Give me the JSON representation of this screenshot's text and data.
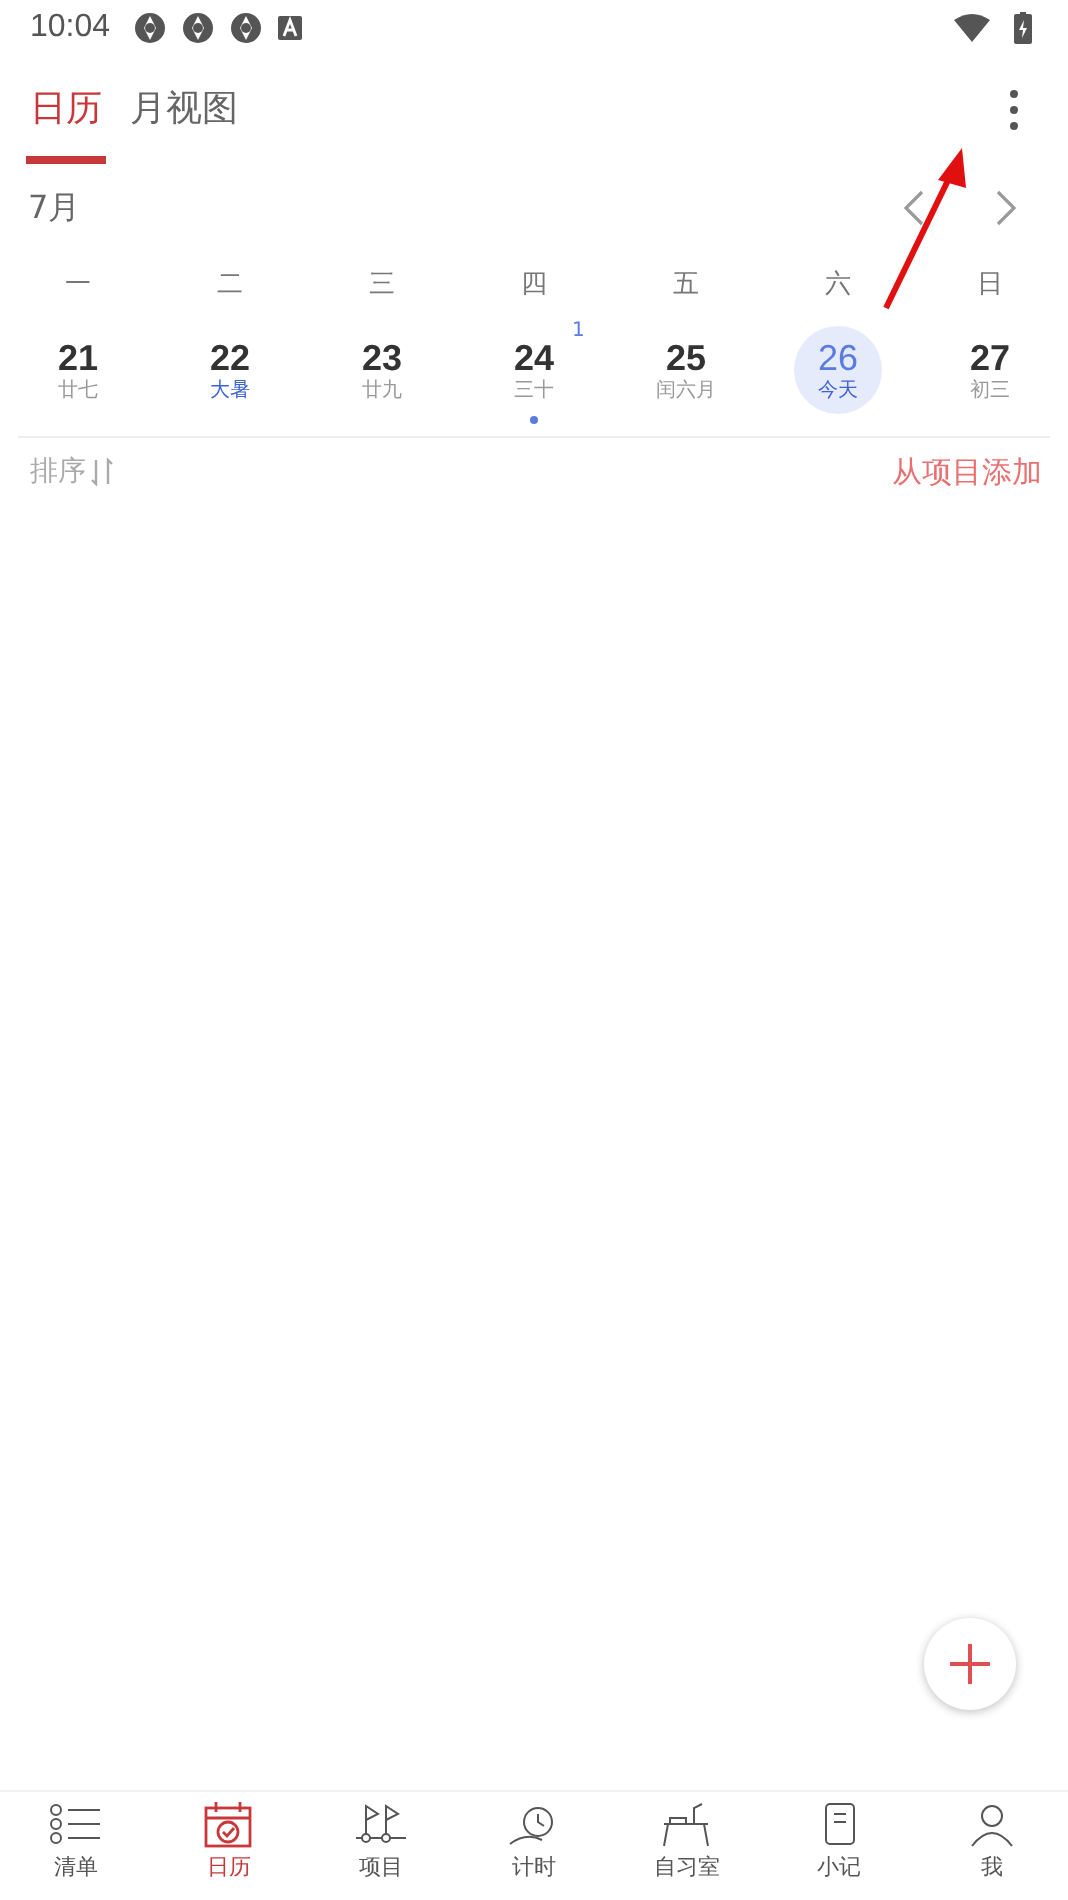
{
  "status_bar": {
    "time": "10:04"
  },
  "tabs": [
    {
      "label": "日历",
      "selected": true
    },
    {
      "label": "月视图",
      "selected": false
    }
  ],
  "month": "7月",
  "weekdays": [
    "一",
    "二",
    "三",
    "四",
    "五",
    "六",
    "日"
  ],
  "days": [
    {
      "day": "21",
      "lunar": "廿七",
      "term": false,
      "selected": false,
      "has_event": false
    },
    {
      "day": "22",
      "lunar": "大暑",
      "term": true,
      "selected": false,
      "has_event": false
    },
    {
      "day": "23",
      "lunar": "廿九",
      "term": false,
      "selected": false,
      "has_event": false
    },
    {
      "day": "24",
      "lunar": "三十",
      "term": false,
      "selected": false,
      "has_event": true,
      "badge": "1"
    },
    {
      "day": "25",
      "lunar": "闰六月",
      "term": false,
      "selected": false,
      "has_event": false
    },
    {
      "day": "26",
      "lunar": "今天",
      "term": false,
      "selected": true,
      "has_event": false
    },
    {
      "day": "27",
      "lunar": "初三",
      "term": false,
      "selected": false,
      "has_event": false
    }
  ],
  "sort_label": "排序",
  "add_link": "从项目添加",
  "nav": [
    {
      "kind": "list",
      "label": "清单",
      "selected": false
    },
    {
      "kind": "calendar",
      "label": "日历",
      "selected": true
    },
    {
      "kind": "flags",
      "label": "项目",
      "selected": false
    },
    {
      "kind": "timer",
      "label": "计时",
      "selected": false
    },
    {
      "kind": "desk",
      "label": "自习室",
      "selected": false
    },
    {
      "kind": "note",
      "label": "小记",
      "selected": false
    },
    {
      "kind": "person",
      "label": "我",
      "selected": false
    }
  ]
}
